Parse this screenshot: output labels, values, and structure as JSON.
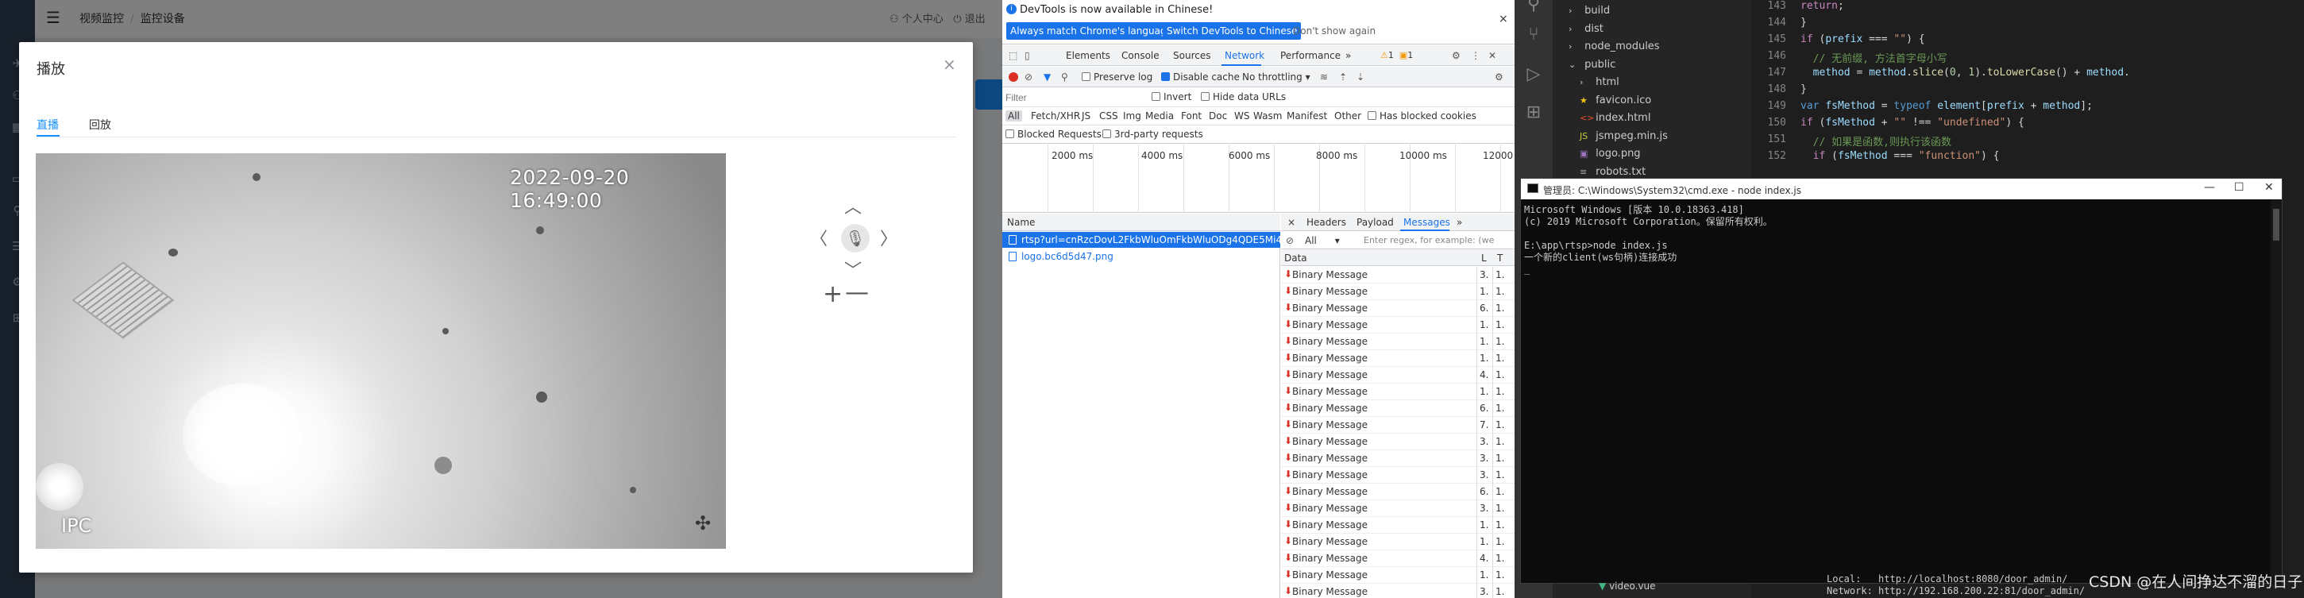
{
  "app": {
    "breadcrumb": [
      "视频监控",
      "监控设备"
    ],
    "header_right": [
      "个人中心",
      "退出"
    ],
    "modal": {
      "title": "播放",
      "close": "×",
      "tabs": [
        "直播",
        "回放"
      ],
      "video": {
        "timestamp": "2022-09-20 16:49:00",
        "label": "IPC",
        "move_icon": "✣"
      },
      "ptz": {
        "up": "︿",
        "down": "﹀",
        "left": "〈",
        "right": "〉",
        "mic_icon": "🎙"
      },
      "zoom_in": "+",
      "zoom_out": "—"
    }
  },
  "devtools": {
    "info_bar": {
      "text": "DevTools is now available in Chinese!",
      "btn_match": "Always match Chrome's language",
      "btn_switch": "Switch DevTools to Chinese",
      "btn_dont": "Don't show again",
      "close": "×"
    },
    "tabs": [
      "Elements",
      "Console",
      "Sources",
      "Network",
      "Performance",
      "»"
    ],
    "warnings": "1",
    "errors": "1",
    "toolbar": {
      "preserve_log": "Preserve log",
      "disable_cache": "Disable cache",
      "throttling": "No throttling"
    },
    "filter": {
      "placeholder": "Filter",
      "invert": "Invert",
      "hide_data_urls": "Hide data URLs"
    },
    "types": [
      "All",
      "Fetch/XHR",
      "JS",
      "CSS",
      "Img",
      "Media",
      "Font",
      "Doc",
      "WS",
      "Wasm",
      "Manifest",
      "Other"
    ],
    "has_blocked_cookies": "Has blocked cookies",
    "blocked_requests": "Blocked Requests",
    "third_party": "3rd-party requests",
    "timeline_ticks": [
      "2000 ms",
      "4000 ms",
      "6000 ms",
      "8000 ms",
      "10000 ms",
      "12000"
    ],
    "list_header": "Name",
    "requests": [
      "rtsp?url=cnRzcDovL2FkbWluOmFkbWluODg4QDE5Mi4xN...",
      "logo.bc6d5d47.png"
    ],
    "detail_tabs": [
      "×",
      "Headers",
      "Payload",
      "Messages",
      "»"
    ],
    "msg_filter": {
      "type": "All",
      "placeholder": "Enter regex, for example: (we"
    },
    "msg_headers": {
      "data": "Data",
      "length": "L",
      "time": "T"
    },
    "messages": [
      {
        "data": "Binary Message",
        "length": "3.",
        "time": "1."
      },
      {
        "data": "Binary Message",
        "length": "1.",
        "time": "1."
      },
      {
        "data": "Binary Message",
        "length": "6.",
        "time": "1."
      },
      {
        "data": "Binary Message",
        "length": "1.",
        "time": "1."
      },
      {
        "data": "Binary Message",
        "length": "1.",
        "time": "1."
      },
      {
        "data": "Binary Message",
        "length": "1.",
        "time": "1."
      },
      {
        "data": "Binary Message",
        "length": "4.",
        "time": "1."
      },
      {
        "data": "Binary Message",
        "length": "1.",
        "time": "1."
      },
      {
        "data": "Binary Message",
        "length": "6.",
        "time": "1."
      },
      {
        "data": "Binary Message",
        "length": "7.",
        "time": "1."
      },
      {
        "data": "Binary Message",
        "length": "3.",
        "time": "1."
      },
      {
        "data": "Binary Message",
        "length": "3.",
        "time": "1."
      },
      {
        "data": "Binary Message",
        "length": "3.",
        "time": "1."
      },
      {
        "data": "Binary Message",
        "length": "6.",
        "time": "1."
      },
      {
        "data": "Binary Message",
        "length": "3.",
        "time": "1."
      },
      {
        "data": "Binary Message",
        "length": "1.",
        "time": "1."
      },
      {
        "data": "Binary Message",
        "length": "1.",
        "time": "1."
      },
      {
        "data": "Binary Message",
        "length": "4.",
        "time": "1."
      },
      {
        "data": "Binary Message",
        "length": "1.",
        "time": "1."
      },
      {
        "data": "Binary Message",
        "length": "3.",
        "time": "1."
      }
    ]
  },
  "vscode": {
    "tree": [
      {
        "icon": "›",
        "name": "build"
      },
      {
        "icon": "›",
        "name": "dist"
      },
      {
        "icon": "›",
        "name": "node_modules"
      },
      {
        "icon": "⌄",
        "name": "public"
      },
      {
        "icon": "›",
        "name": "html"
      },
      {
        "icon": "★",
        "name": "favicon.ico"
      },
      {
        "icon": "<>",
        "name": "index.html"
      },
      {
        "icon": "JS",
        "name": "jsmpeg.min.js"
      },
      {
        "icon": "▣",
        "name": "logo.png"
      },
      {
        "icon": "≡",
        "name": "robots.txt"
      }
    ],
    "line_numbers": [
      "143",
      "144",
      "145",
      "146",
      "147",
      "148",
      "149",
      "150",
      "151",
      "152"
    ],
    "bottom_file": "video.vue",
    "bottom_term_local": "Local:   http://localhost:8080/door_admin/",
    "bottom_term_network": "Network: http://192.168.200.22:81/door_admin/"
  },
  "cmd": {
    "title": "管理员: C:\\Windows\\System32\\cmd.exe - node  index.js",
    "buttons": [
      "—",
      "☐",
      "✕"
    ],
    "lines": [
      "Microsoft Windows [版本 10.0.18363.418]",
      "(c) 2019 Microsoft Corporation。保留所有权利。",
      "",
      "E:\\app\\rtsp>node index.js",
      "一个新的client(ws句柄)连接成功",
      "_"
    ]
  },
  "watermark": "CSDN @在人间挣达不溜的日子"
}
